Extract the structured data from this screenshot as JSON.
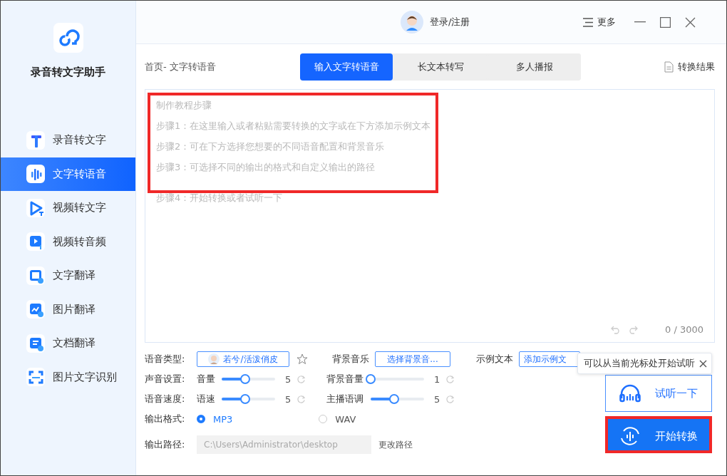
{
  "sidebar": {
    "app_name": "录音转文字助手",
    "items": [
      {
        "label": "录音转文字",
        "kind": "text",
        "selected": false
      },
      {
        "label": "文字转语音",
        "kind": "wave",
        "selected": true
      },
      {
        "label": "视频转文字",
        "kind": "play",
        "selected": false
      },
      {
        "label": "视频转音频",
        "kind": "video",
        "selected": false
      },
      {
        "label": "文字翻译",
        "kind": "translate",
        "selected": false
      },
      {
        "label": "图片翻译",
        "kind": "image",
        "selected": false
      },
      {
        "label": "文档翻译",
        "kind": "doc",
        "selected": false
      },
      {
        "label": "图片文字识别",
        "kind": "scan",
        "selected": false
      }
    ]
  },
  "topbar": {
    "login": "登录/注册",
    "more": "更多"
  },
  "breadcrumb": "首页- 文字转语音",
  "tabs": [
    {
      "label": "输入文字转语音",
      "selected": true
    },
    {
      "label": "长文本转写",
      "selected": false
    },
    {
      "label": "多人播报",
      "selected": false
    }
  ],
  "results_link": "转换结果",
  "editor": {
    "highlighted": true,
    "placeholder_lines": [
      "制作教程步骤",
      "步骤1：在这里输入或者粘贴需要转换的文字或在下方添加示例文本",
      "步骤2：可在下方选择您想要的不同语音配置和背景音乐",
      "步骤3：可选择不同的输出的格式和自定义输出的路径",
      "步骤4：开始转换或者试听一下"
    ],
    "counter": "0 / 3000"
  },
  "voice": {
    "label": "语音类型:",
    "value": "若兮/活泼俏皮"
  },
  "background_music": {
    "label": "背景音乐",
    "button": "选择背景音..."
  },
  "sample_text": {
    "label": "示例文本",
    "button": "添加示例文"
  },
  "slider_rows": [
    {
      "label": "声音设置:",
      "sliders": [
        {
          "name": "音量",
          "level": 0.44,
          "reading": "5"
        },
        {
          "name": "背景音量",
          "level": 0,
          "reading": "1"
        }
      ]
    },
    {
      "label": "语音速度:",
      "sliders": [
        {
          "name": "语速",
          "level": 0.44,
          "reading": "5"
        },
        {
          "name": "主播语调",
          "level": 0.44,
          "reading": "5"
        }
      ]
    }
  ],
  "output_format": {
    "label": "输出格式:",
    "options": [
      {
        "label": "MP3",
        "selected": true
      },
      {
        "label": "WAV",
        "selected": false
      }
    ]
  },
  "output_path": {
    "label": "输出路径:",
    "value": "C:\\Users\\Administrator\\desktop",
    "change": "更改路径"
  },
  "tooltip": "可以从当前光标处开始试听",
  "listen_button": "试听一下",
  "start_button": {
    "label": "开始转换",
    "highlighted": true
  }
}
